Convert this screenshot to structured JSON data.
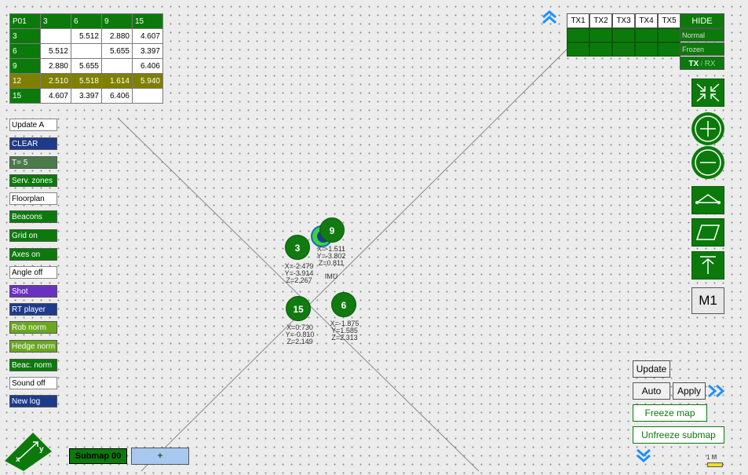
{
  "table": {
    "header": [
      "P01",
      "3",
      "6",
      "9",
      "15"
    ],
    "rows": [
      {
        "id": "3",
        "cells": [
          "",
          "5.512",
          "2.880",
          "4.607"
        ],
        "highlight": false
      },
      {
        "id": "6",
        "cells": [
          "5.512",
          "",
          "5.655",
          "3.397"
        ],
        "highlight": false
      },
      {
        "id": "9",
        "cells": [
          "2.880",
          "5.655",
          "",
          "6.406"
        ],
        "highlight": false
      },
      {
        "id": "12",
        "cells": [
          "2.510",
          "5.518",
          "1.614",
          "5.940"
        ],
        "highlight": true
      },
      {
        "id": "15",
        "cells": [
          "4.607",
          "3.397",
          "6.406",
          ""
        ],
        "highlight": false
      }
    ]
  },
  "left_buttons": {
    "update_a": "Update A",
    "clear": "CLEAR",
    "t": "T= 5",
    "serv_zones": "Serv. zones",
    "floorplan": "Floorplan",
    "beacons": "Beacons",
    "grid_on": "Grid on",
    "axes_on": "Axes on",
    "angle_off": "Angle off",
    "shot": "Shot",
    "rt_player": "RT player",
    "rob_norm": "Rob norm",
    "hedge_norm": "Hedge norm",
    "beac_norm": "Beac. norm",
    "sound_off": "Sound off",
    "new_log": "New log"
  },
  "nodes": {
    "n3": {
      "label": "3",
      "coords": "X=-2.479\nY=-3.914\nZ=2.267"
    },
    "n9": {
      "label": "9",
      "coords": "X=-1.511\nY=-3.802\nZ=0.811"
    },
    "n15": {
      "label": "15",
      "coords": "X=0.730\nY=-0.810\nZ=2.149"
    },
    "n6": {
      "label": "6",
      "coords": "X=-1.875\nY=1.585\nZ=2.313"
    },
    "imu": "IMU"
  },
  "tx_panel": {
    "headers": [
      "TX1",
      "TX2",
      "TX3",
      "TX4",
      "TX5"
    ],
    "hide": "HIDE",
    "normal": "Normal",
    "frozen": "Frozen",
    "tx": "TX",
    "slash": "/",
    "rx": "RX"
  },
  "right_buttons": {
    "m1": "M1",
    "update": "Update",
    "auto": "Auto",
    "apply": "Apply",
    "freeze_map": "Freeze map",
    "unfreeze_submap": "Unfreeze submap"
  },
  "bottom": {
    "submap": "Submap 00",
    "plus": "+",
    "scale": "1 M",
    "compass_x": "x",
    "compass_y": "y"
  },
  "colors": {
    "accent_green": "#0b7a0b",
    "highlight_olive": "#7f7f00",
    "link_blue": "#1e90ff"
  }
}
